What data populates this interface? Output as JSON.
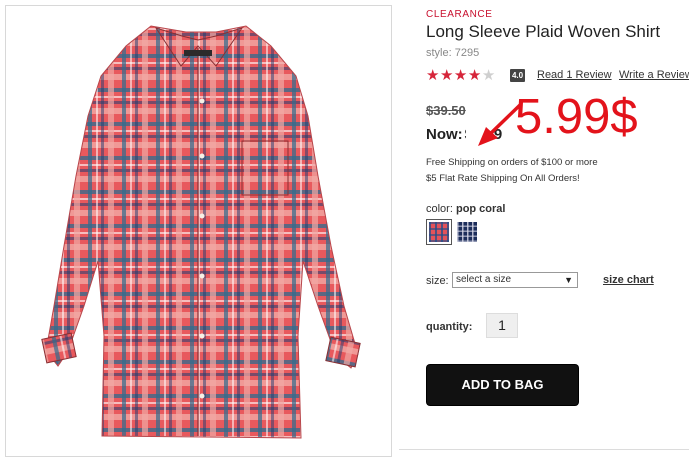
{
  "product": {
    "badge": "CLEARANCE",
    "title": "Long Sleeve Plaid Woven Shirt",
    "style_label": "style: 7295",
    "rating": {
      "stars_filled": 4,
      "stars_total": 5,
      "value": "4.0"
    },
    "read_review": "Read 1 Review",
    "write_review": "Write a Review",
    "old_price": "$39.50",
    "now_label": "Now:",
    "now_amount": "$5.99",
    "shipping_line_1": "Free Shipping on orders of $100 or more",
    "shipping_line_2": "$5 Flat Rate Shipping On All Orders!",
    "color_label": "color:",
    "color_value": "pop coral",
    "swatches": [
      {
        "name": "pop coral",
        "color": "#e4535a",
        "selected": true
      },
      {
        "name": "navy",
        "color": "#1c2d5a",
        "selected": false
      }
    ],
    "size_label": "size:",
    "size_placeholder": "select a size",
    "size_chart": "size chart",
    "quantity_label": "quantity:",
    "quantity_value": "1",
    "add_to_bag": "ADD TO BAG"
  },
  "annotation": {
    "text": "5.99$",
    "color": "#e3131b"
  },
  "colors": {
    "accent_red": "#c8102e",
    "star_red": "#d6253a",
    "button_black": "#111111"
  }
}
